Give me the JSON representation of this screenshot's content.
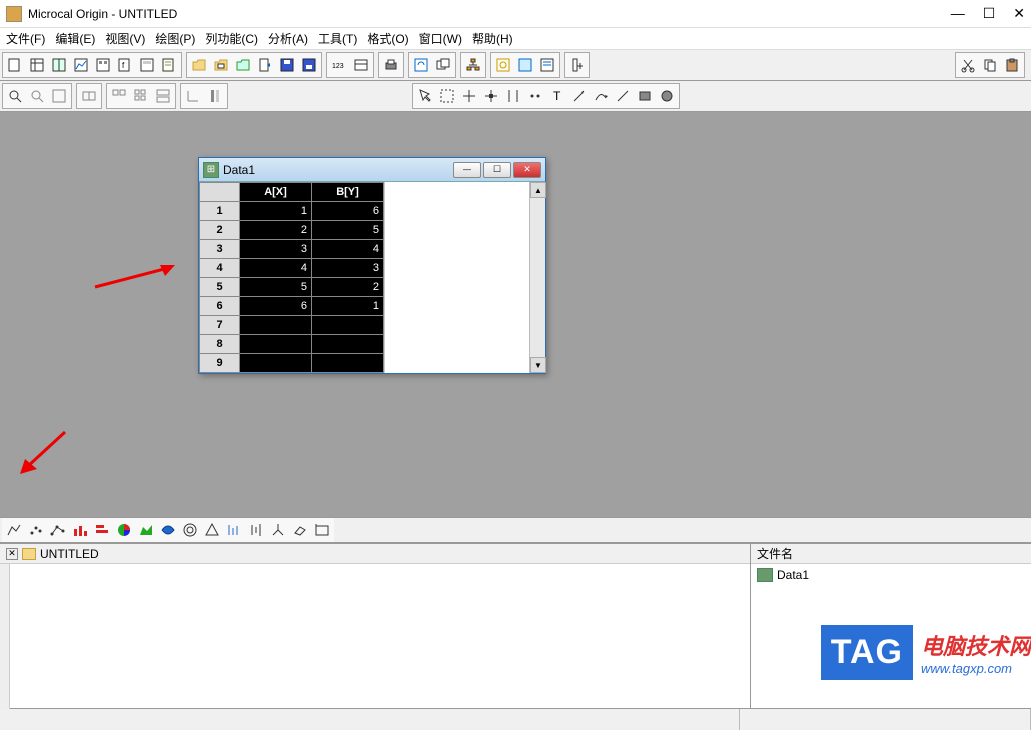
{
  "app": {
    "title": "Microcal Origin - UNTITLED"
  },
  "menu": {
    "file": "文件(F)",
    "edit": "编辑(E)",
    "view": "视图(V)",
    "plot": "绘图(P)",
    "column": "列功能(C)",
    "analysis": "分析(A)",
    "tools": "工具(T)",
    "format": "格式(O)",
    "window": "窗口(W)",
    "help": "帮助(H)"
  },
  "datawin": {
    "title": "Data1",
    "columns": [
      "A[X]",
      "B[Y]"
    ],
    "rows": [
      {
        "n": "1",
        "a": "1",
        "b": "6"
      },
      {
        "n": "2",
        "a": "2",
        "b": "5"
      },
      {
        "n": "3",
        "a": "3",
        "b": "4"
      },
      {
        "n": "4",
        "a": "4",
        "b": "3"
      },
      {
        "n": "5",
        "a": "5",
        "b": "2"
      },
      {
        "n": "6",
        "a": "6",
        "b": "1"
      },
      {
        "n": "7",
        "a": "",
        "b": ""
      },
      {
        "n": "8",
        "a": "",
        "b": ""
      },
      {
        "n": "9",
        "a": "",
        "b": ""
      }
    ]
  },
  "project": {
    "name": "UNTITLED"
  },
  "filepanel": {
    "header": "文件名",
    "file": "Data1"
  },
  "watermark": {
    "tag": "TAG",
    "line1": "电脑技术网",
    "line2": "www.tagxp.com"
  },
  "chart_data": {
    "type": "table",
    "columns": [
      "A[X]",
      "B[Y]"
    ],
    "data": [
      [
        1,
        6
      ],
      [
        2,
        5
      ],
      [
        3,
        4
      ],
      [
        4,
        3
      ],
      [
        5,
        2
      ],
      [
        6,
        1
      ]
    ]
  }
}
